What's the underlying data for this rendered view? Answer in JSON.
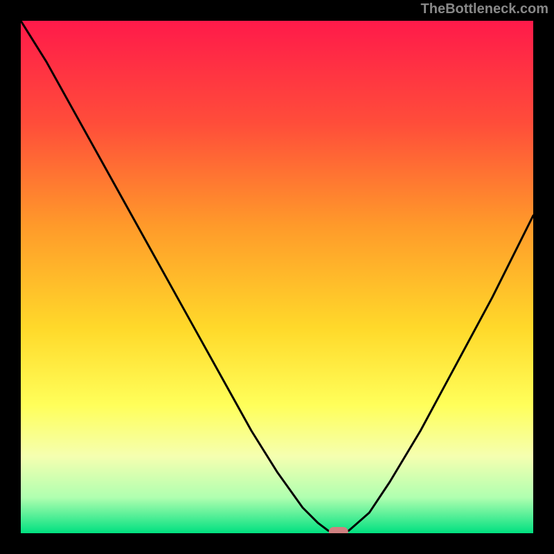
{
  "watermark": "TheBottleneck.com",
  "chart_data": {
    "type": "line",
    "title": "",
    "xlabel": "",
    "ylabel": "",
    "xlim": [
      0,
      100
    ],
    "ylim": [
      0,
      100
    ],
    "background_gradient": {
      "stops": [
        {
          "offset": 0,
          "color": "#ff1a4a"
        },
        {
          "offset": 20,
          "color": "#ff4d3a"
        },
        {
          "offset": 40,
          "color": "#ff9a2a"
        },
        {
          "offset": 60,
          "color": "#ffd92a"
        },
        {
          "offset": 75,
          "color": "#ffff5a"
        },
        {
          "offset": 85,
          "color": "#f5ffb0"
        },
        {
          "offset": 93,
          "color": "#b0ffb0"
        },
        {
          "offset": 100,
          "color": "#00e080"
        }
      ]
    },
    "curve": {
      "description": "V-shaped bottleneck curve, minimum near x=62",
      "x": [
        0,
        5,
        10,
        15,
        20,
        25,
        30,
        35,
        40,
        45,
        50,
        55,
        58,
        60,
        62,
        64,
        68,
        72,
        78,
        85,
        92,
        100
      ],
      "y": [
        100,
        92,
        83,
        74,
        65,
        56,
        47,
        38,
        29,
        20,
        12,
        5,
        2,
        0.5,
        0,
        0.5,
        4,
        10,
        20,
        33,
        46,
        62
      ]
    },
    "marker": {
      "x": 62,
      "y": 0,
      "color": "#d08080",
      "shape": "rounded-rect"
    }
  }
}
